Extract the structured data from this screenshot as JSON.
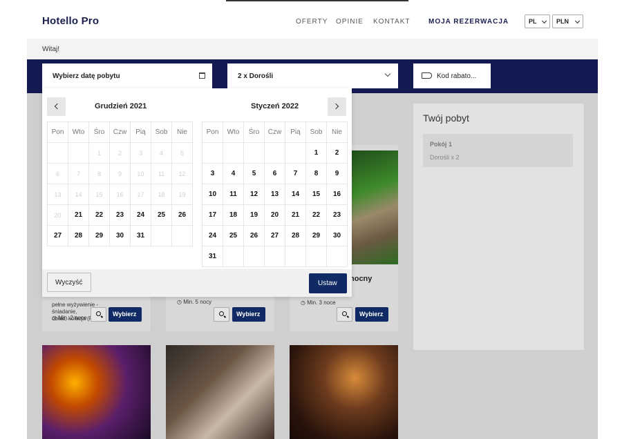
{
  "header": {
    "logo": "Hotello Pro",
    "nav": [
      "OFERTY",
      "OPINIE",
      "KONTAKT"
    ],
    "reservation": "MOJA REZERWACJA",
    "language": "PL",
    "currency": "PLN"
  },
  "greeting": "Witaj!",
  "search": {
    "date_placeholder": "Wybierz datę pobytu",
    "guests": "2 x Dorośli",
    "coupon": "Kod rabato..."
  },
  "summary": {
    "title": "Twój pobyt",
    "room": "Pokój 1",
    "guests": "Dorośli x 2"
  },
  "cards": {
    "c1_line1": "pełne wyżywienie - śniadanie,",
    "c1_line2": "obiad, kolacja (FB",
    "c1_nights": "Min. 2 noce",
    "c2_nights": "Min. 5 nocy",
    "c3_nights": "Min. 3 noce",
    "c3_title": "nocny",
    "choose_label": "Wybierz"
  },
  "calendar": {
    "weekdays": [
      "Pon",
      "Wto",
      "Śro",
      "Czw",
      "Pią",
      "Sob",
      "Nie"
    ],
    "months": [
      {
        "title": "Grudzień 2021",
        "lead_blanks": 2,
        "past_days": [
          "1",
          "2",
          "3",
          "4",
          "5",
          "6",
          "7",
          "8",
          "9",
          "10",
          "11",
          "12",
          "13",
          "14",
          "15",
          "16",
          "17",
          "18",
          "19",
          "20"
        ],
        "days": [
          "21",
          "22",
          "23",
          "24",
          "25",
          "26",
          "27",
          "28",
          "29",
          "30",
          "31"
        ]
      },
      {
        "title": "Styczeń 2022",
        "lead_blanks": 5,
        "past_days": [],
        "days": [
          "1",
          "2",
          "3",
          "4",
          "5",
          "6",
          "7",
          "8",
          "9",
          "10",
          "11",
          "12",
          "13",
          "14",
          "15",
          "16",
          "17",
          "18",
          "19",
          "20",
          "21",
          "22",
          "23",
          "24",
          "25",
          "26",
          "27",
          "28",
          "29",
          "30",
          "31"
        ]
      }
    ],
    "clear_label": "Wyczyść",
    "set_label": "Ustaw"
  }
}
